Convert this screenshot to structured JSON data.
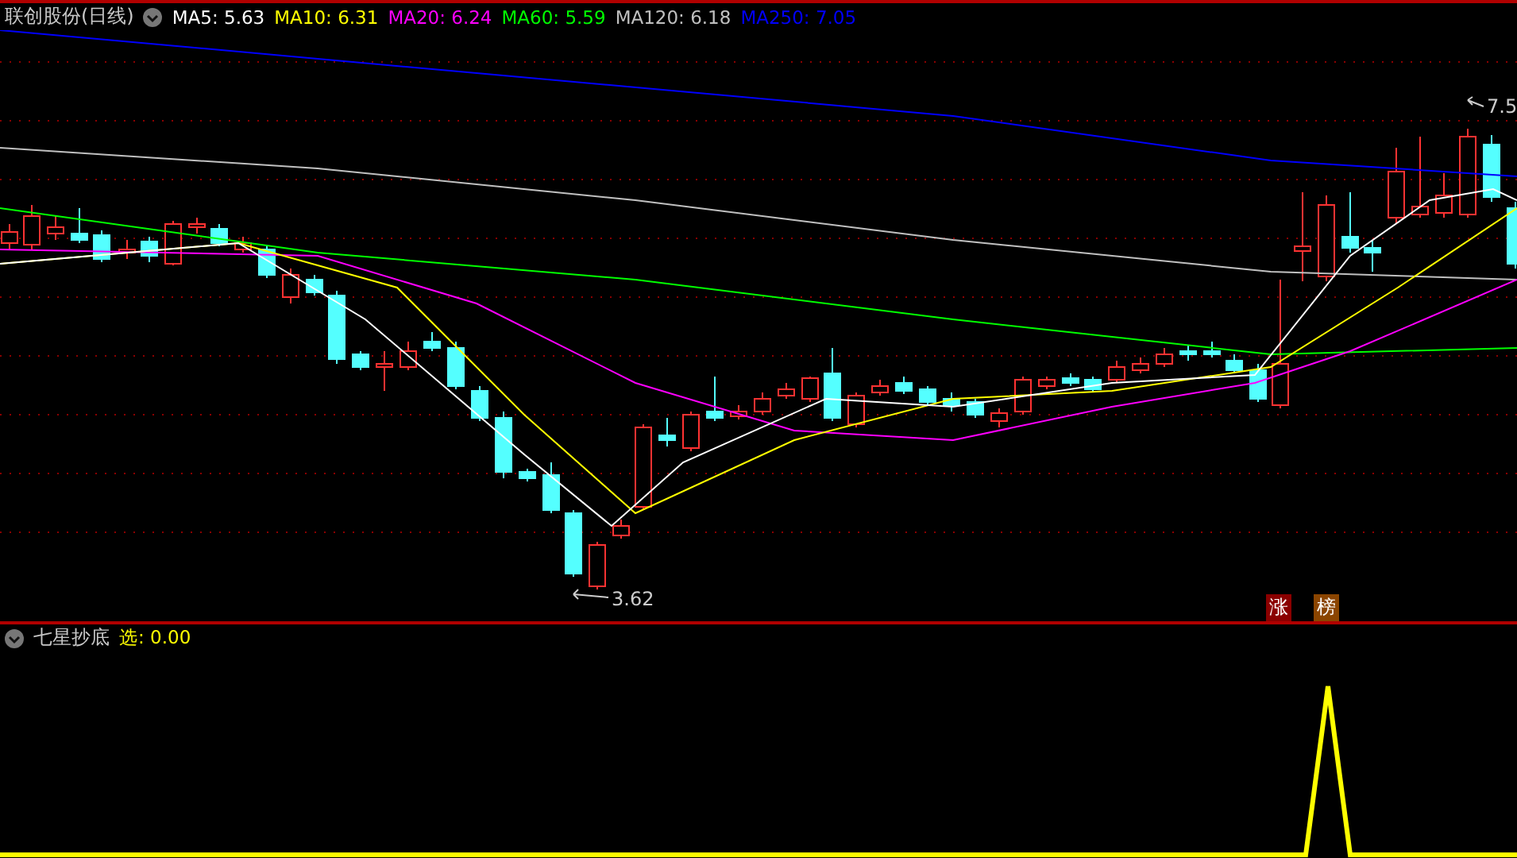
{
  "instrument": {
    "name": "联创股份(日线)"
  },
  "indicators": [
    {
      "text": "MA5: 5.63",
      "color": "#ffffff"
    },
    {
      "text": "MA10: 6.31",
      "color": "#ffff00"
    },
    {
      "text": "MA20: 6.24",
      "color": "#ff00ff"
    },
    {
      "text": "MA60: 5.59",
      "color": "#00ff00"
    },
    {
      "text": "MA120: 6.18",
      "color": "#c0c0c0"
    },
    {
      "text": "MA250: 7.05",
      "color": "#0000ff"
    }
  ],
  "price_chart": {
    "high_label": "7.5",
    "low_label": "3.62",
    "badges": [
      {
        "text": "涨",
        "color": "#8b0000"
      },
      {
        "text": "榜",
        "color": "#8b4500"
      }
    ]
  },
  "sub_chart": {
    "title": "七星抄底",
    "indicator": "选: 0.00"
  }
}
